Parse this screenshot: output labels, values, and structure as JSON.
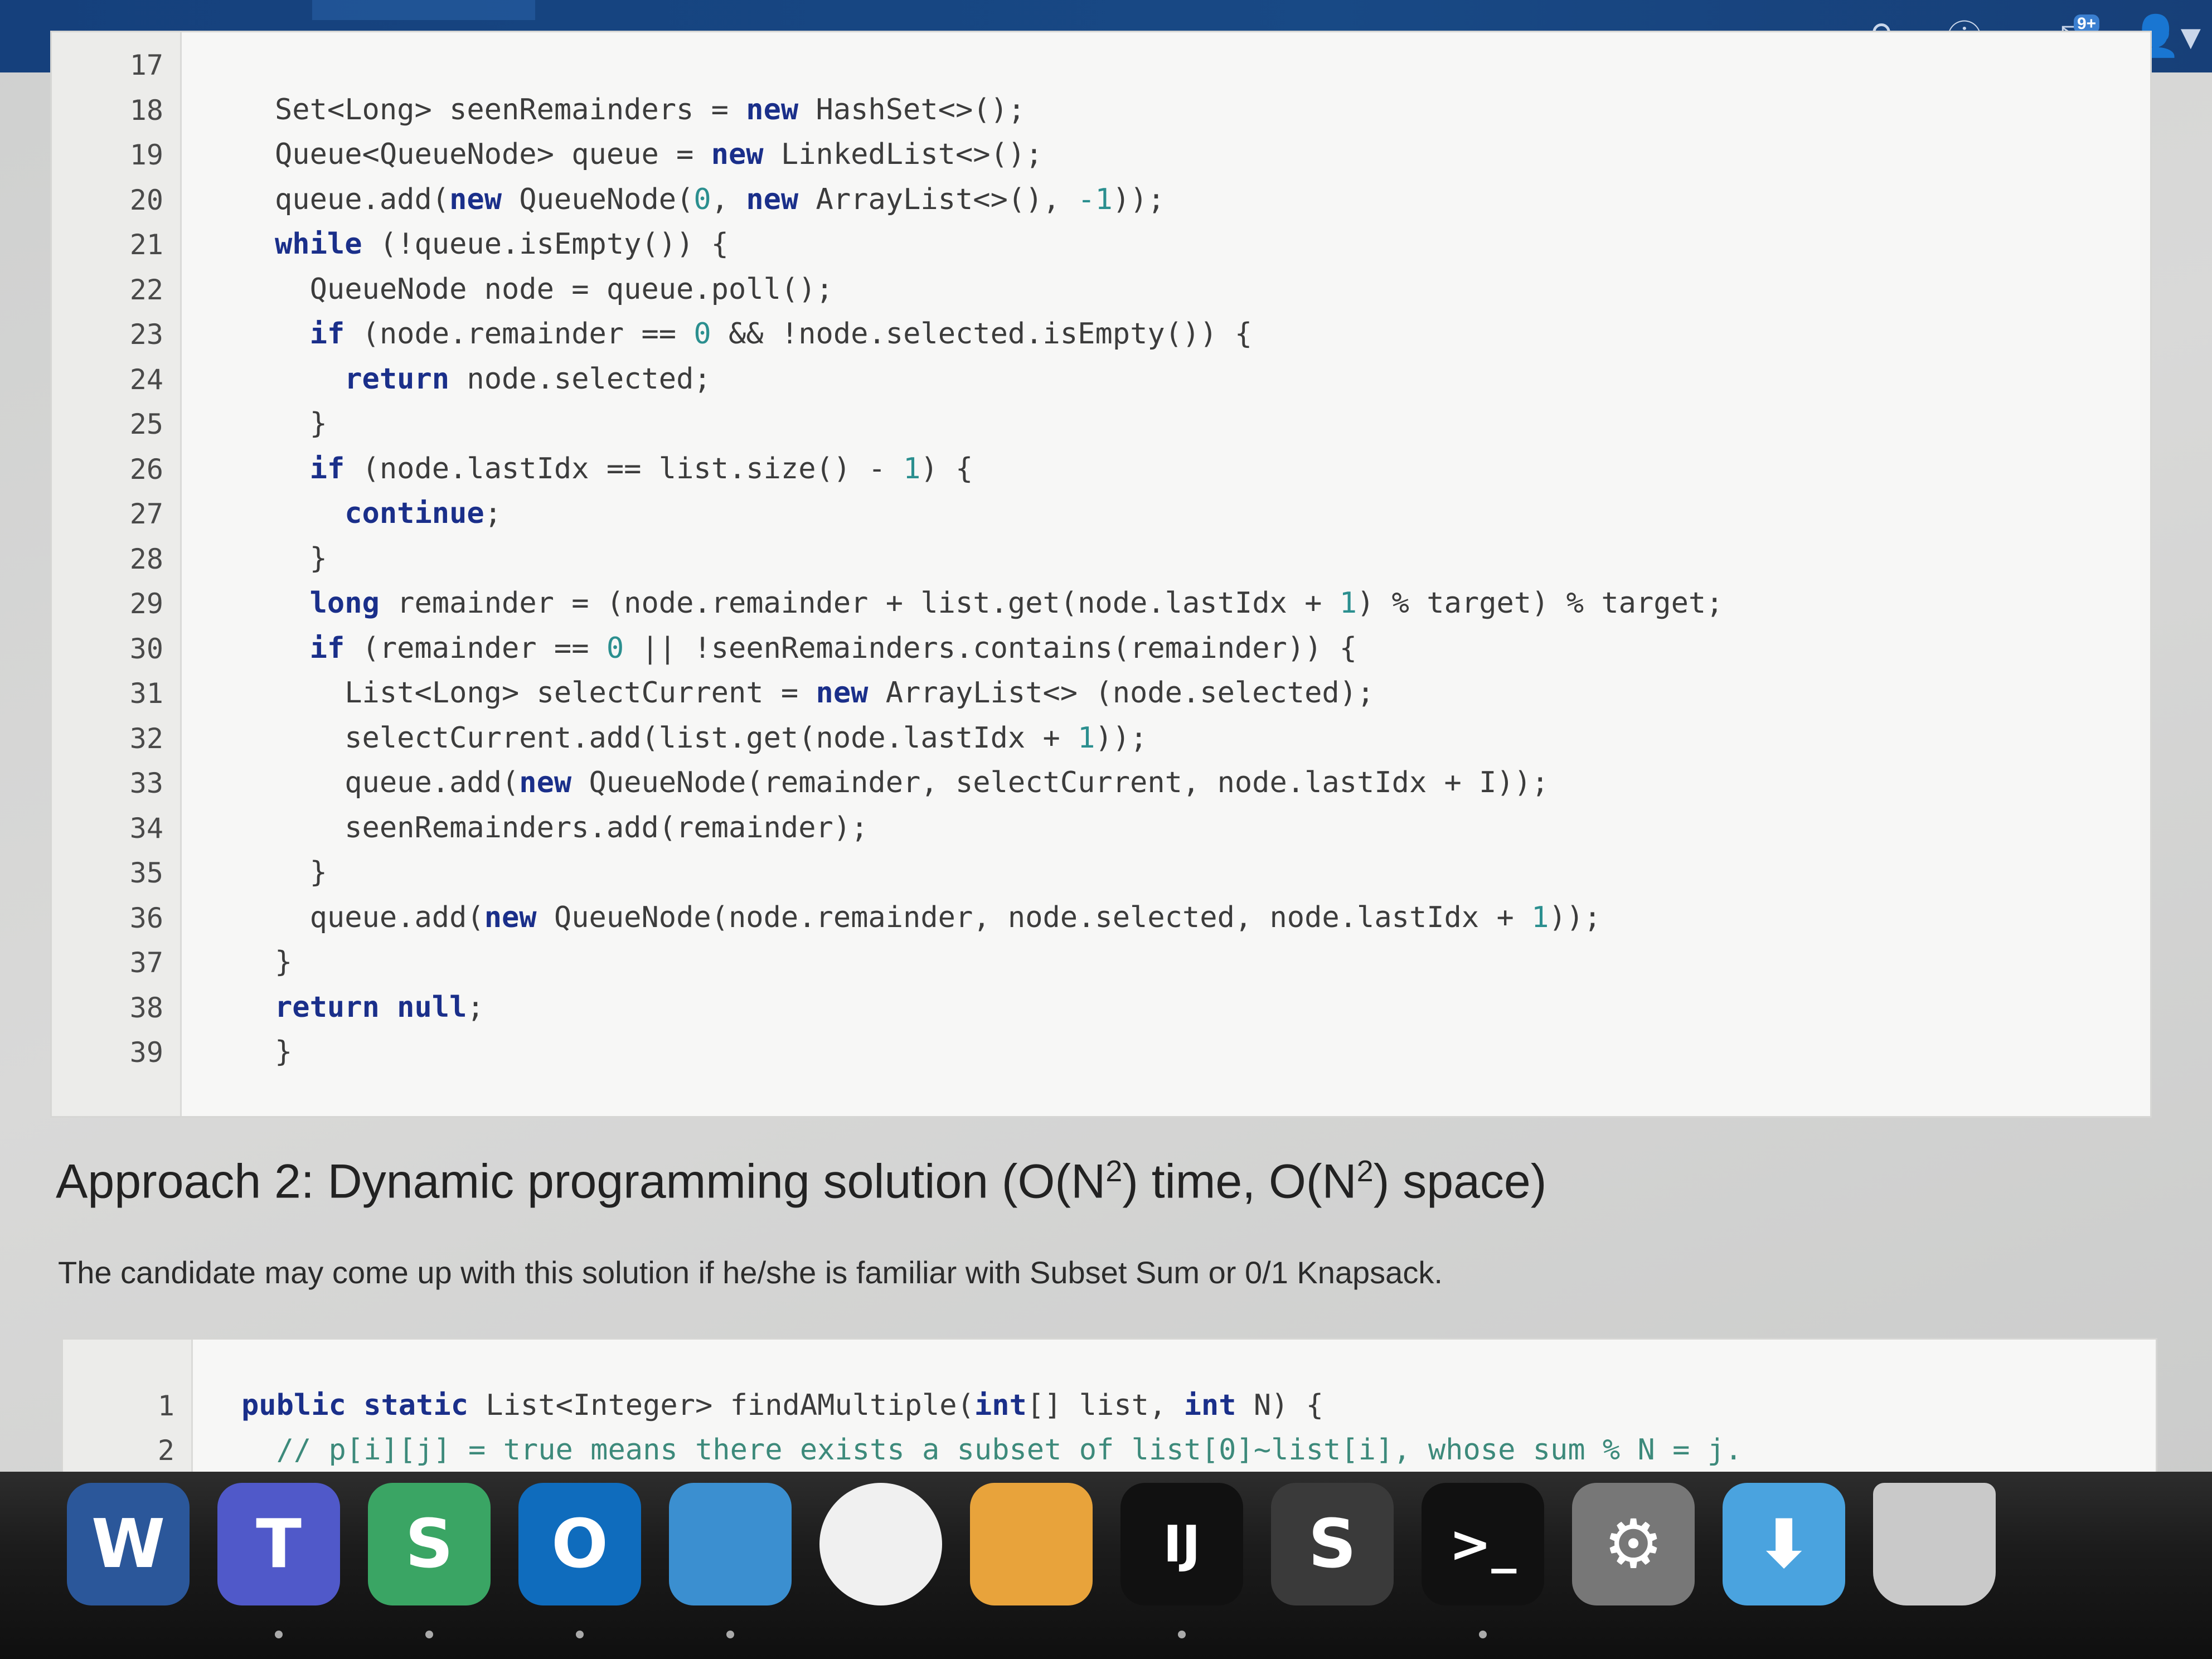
{
  "header": {
    "notification_count": "9+"
  },
  "code_top": {
    "lines": [
      {
        "n": "17",
        "html": ""
      },
      {
        "n": "18",
        "html": "Set&lt;Long&gt; seenRemainders = <span class=\"kw\">new</span> HashSet&lt;&gt;();"
      },
      {
        "n": "19",
        "html": "Queue&lt;QueueNode&gt; queue = <span class=\"kw\">new</span> LinkedList&lt;&gt;();"
      },
      {
        "n": "20",
        "html": "queue.add(<span class=\"kw\">new</span> QueueNode(<span class=\"num\">0</span>, <span class=\"kw\">new</span> ArrayList&lt;&gt;(), <span class=\"num\">-1</span>));"
      },
      {
        "n": "21",
        "html": "<span class=\"kw\">while</span> (!queue.isEmpty()) {"
      },
      {
        "n": "22",
        "html": "  QueueNode node = queue.poll();"
      },
      {
        "n": "23",
        "html": "  <span class=\"kw\">if</span> (node.remainder == <span class=\"num\">0</span> &amp;&amp; !node.selected.isEmpty()) {"
      },
      {
        "n": "24",
        "html": "    <span class=\"kw\">return</span> node.selected;"
      },
      {
        "n": "25",
        "html": "  }"
      },
      {
        "n": "26",
        "html": "  <span class=\"kw\">if</span> (node.lastIdx == list.size() - <span class=\"num\">1</span>) {"
      },
      {
        "n": "27",
        "html": "    <span class=\"kw\">continue</span>;"
      },
      {
        "n": "28",
        "html": "  }"
      },
      {
        "n": "29",
        "html": "  <span class=\"kw\">long</span> remainder = (node.remainder + list.get(node.lastIdx + <span class=\"num\">1</span>) % target) % target;"
      },
      {
        "n": "30",
        "html": "  <span class=\"kw\">if</span> (remainder == <span class=\"num\">0</span> || !seenRemainders.contains(remainder)) {"
      },
      {
        "n": "31",
        "html": "    List&lt;Long&gt; selectCurrent = <span class=\"kw\">new</span> ArrayList&lt;&gt; (node.selected);"
      },
      {
        "n": "32",
        "html": "    selectCurrent.add(list.get(node.lastIdx + <span class=\"num\">1</span>));"
      },
      {
        "n": "33",
        "html": "    queue.add(<span class=\"kw\">new</span> QueueNode(remainder, selectCurrent, node.lastIdx + I));"
      },
      {
        "n": "34",
        "html": "    seenRemainders.add(remainder);"
      },
      {
        "n": "35",
        "html": "  }"
      },
      {
        "n": "36",
        "html": "  queue.add(<span class=\"kw\">new</span> QueueNode(node.remainder, node.selected, node.lastIdx + <span class=\"num\">1</span>));"
      },
      {
        "n": "37",
        "html": "}"
      },
      {
        "n": "38",
        "html": "<span class=\"kw\">return</span> <span class=\"kw\">null</span>;"
      },
      {
        "n": "39",
        "html": "}"
      }
    ]
  },
  "section": {
    "heading_pre": "Approach 2: Dynamic programming solution (O(N",
    "heading_sup1": "2",
    "heading_mid": ") time, O(N",
    "heading_sup2": "2",
    "heading_post": ") space)",
    "paragraph": "The candidate may come up with this solution if he/she is familiar with Subset Sum or 0/1 Knapsack."
  },
  "code_bottom": {
    "lines": [
      {
        "n": "1",
        "html": "<span class=\"kw\">public</span> <span class=\"kw\">static</span> List&lt;Integer&gt; findAMultiple(<span class=\"kw\">int</span>[] list, <span class=\"kw\">int</span> N) {"
      },
      {
        "n": "2",
        "html": "  <span class=\"cm\">// p[i][j] = true means there exists a subset of list[0]~list[i], whose sum % N = j.</span>"
      }
    ]
  },
  "dock": {
    "items": [
      {
        "name": "word-icon",
        "label": "W",
        "color": "#2b579a"
      },
      {
        "name": "teams-icon",
        "label": "T",
        "color": "#5059c9"
      },
      {
        "name": "slack-icon",
        "label": "S",
        "color": "#3aa564"
      },
      {
        "name": "outlook-icon",
        "label": "O",
        "color": "#0f6cbd"
      },
      {
        "name": "vpn-icon",
        "label": "",
        "color": "#3b8fd0"
      },
      {
        "name": "wifi-icon",
        "label": "",
        "color": "#f0f0f0"
      },
      {
        "name": "self-service-icon",
        "label": "",
        "color": "#e8a33b"
      },
      {
        "name": "intellij-icon",
        "label": "IJ",
        "color": "#111111"
      },
      {
        "name": "sublime-icon",
        "label": "S",
        "color": "#3a3a3a"
      },
      {
        "name": "terminal-icon",
        "label": ">_",
        "color": "#111111"
      },
      {
        "name": "system-preferences-icon",
        "label": "⚙",
        "color": "#777777"
      },
      {
        "name": "downloads-folder-icon",
        "label": "⬇",
        "color": "#4aa3df"
      },
      {
        "name": "trash-icon",
        "label": "",
        "color": "#c9c9c9"
      }
    ]
  }
}
